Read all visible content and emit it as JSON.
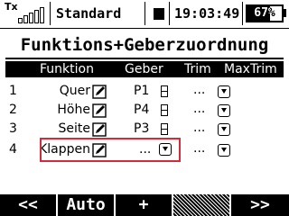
{
  "status": {
    "tx_label": "Tx",
    "model_name": "Standard",
    "time": "19:03:49",
    "battery_percent": 67,
    "battery_text": "67%"
  },
  "title": "Funktions+Geberzuordnung",
  "columns": [
    "Funktion",
    "Geber",
    "Trim",
    "MaxTrim"
  ],
  "rows": [
    {
      "num": "1",
      "function": "Quer",
      "geber": "P1",
      "trim": "...",
      "has_geber_box": true
    },
    {
      "num": "2",
      "function": "Höhe",
      "geber": "P4",
      "trim": "...",
      "has_geber_box": true
    },
    {
      "num": "3",
      "function": "Seite",
      "geber": "P3",
      "trim": "...",
      "has_geber_box": true
    },
    {
      "num": "4",
      "function": "Klappen",
      "geber": "...",
      "trim": "...",
      "has_geber_box": false
    }
  ],
  "softkeys": [
    "<<",
    "Auto",
    "+",
    "",
    ">>"
  ],
  "colors": {
    "highlight_border": "#d22c3a",
    "foreground": "#000000",
    "background": "#ffffff"
  }
}
